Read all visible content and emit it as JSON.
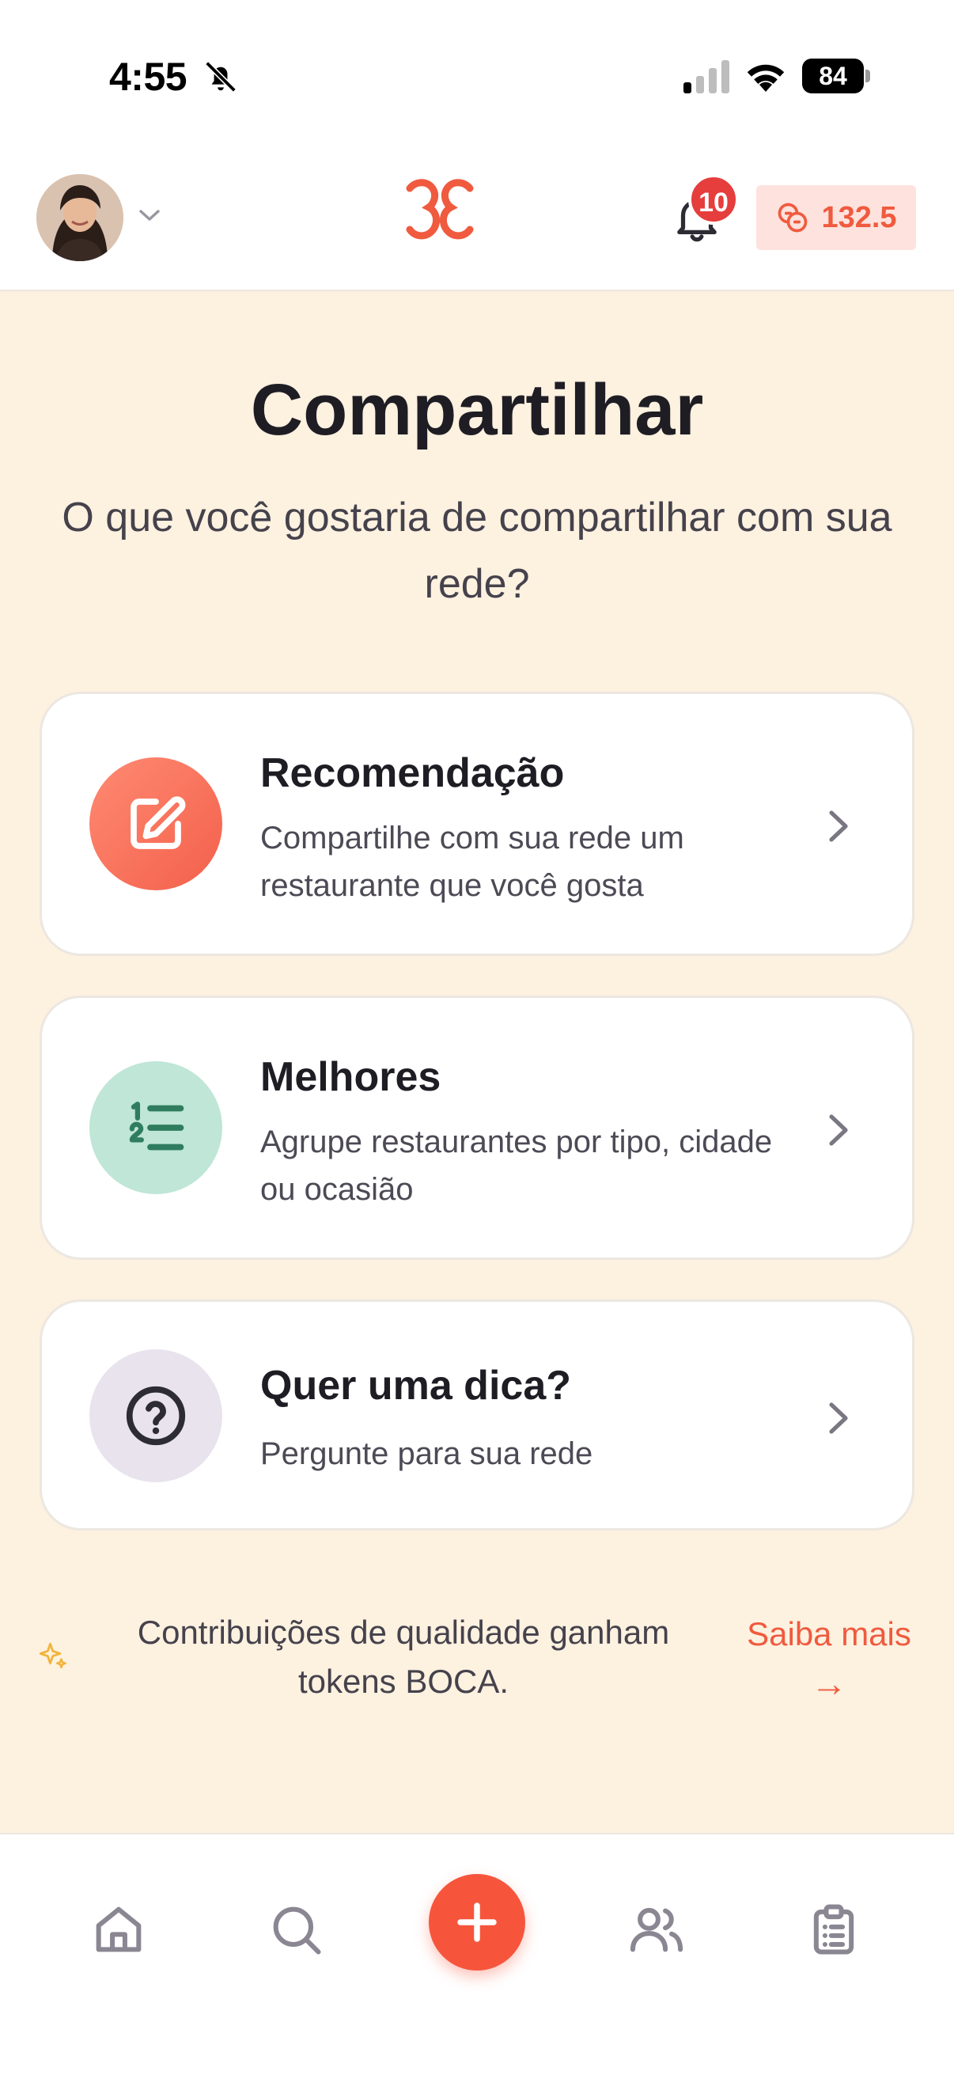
{
  "status_bar": {
    "time": "4:55",
    "battery": "84"
  },
  "header": {
    "notification_count": "10",
    "token_balance": "132.5"
  },
  "main": {
    "title": "Compartilhar",
    "subtitle": "O que você gostaria de compartilhar com sua rede?",
    "cards": [
      {
        "title": "Recomendação",
        "description": "Compartilhe com sua rede um restaurante que você gosta",
        "icon": "edit-icon"
      },
      {
        "title": "Melhores",
        "description": "Agrupe restaurantes por tipo, cidade ou ocasião",
        "icon": "numbered-list-icon"
      },
      {
        "title": "Quer uma dica?",
        "description": "Pergunte para sua rede",
        "icon": "question-icon"
      }
    ],
    "footer_note": "Contribuições de qualidade ganham tokens BOCA.",
    "learn_more": "Saiba mais",
    "learn_more_arrow": "→"
  },
  "bottom_nav": {
    "items": [
      "home-icon",
      "search-icon",
      "add-icon",
      "friends-icon",
      "clipboard-icon"
    ]
  },
  "colors": {
    "accent": "#f05a3e",
    "background": "#fdf1e0",
    "card_green": "#bfe6d7",
    "card_lavender": "#e8e3ec"
  }
}
